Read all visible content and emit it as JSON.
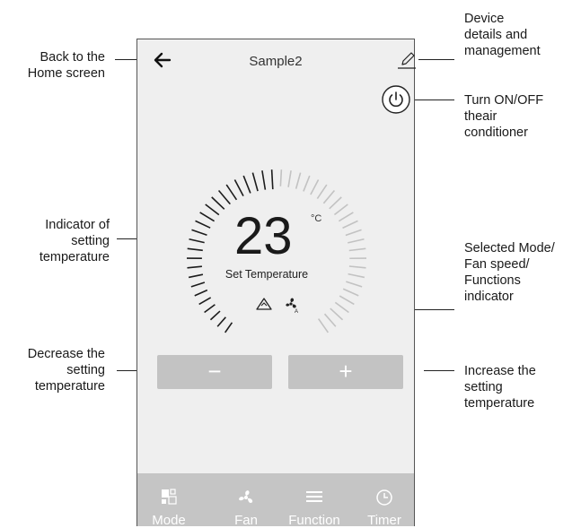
{
  "app": {
    "title": "Sample2",
    "temperature": "23",
    "unit": "°C",
    "set_label": "Set Temperature",
    "minus_label": "−",
    "plus_label": "+"
  },
  "tabs": [
    {
      "label": "Mode",
      "icon": "mode-icon"
    },
    {
      "label": "Fan",
      "icon": "fan-icon"
    },
    {
      "label": "Function",
      "icon": "menu-icon"
    },
    {
      "label": "Timer",
      "icon": "clock-icon"
    }
  ],
  "annotations": {
    "back": [
      "Back to the",
      "Home screen"
    ],
    "device": [
      "Device",
      "details and",
      "management"
    ],
    "power": [
      "Turn ON/OFF",
      "theair",
      "conditioner"
    ],
    "indicator": [
      "Indicator of",
      "setting",
      "temperature"
    ],
    "mode": [
      "Selected Mode/",
      "Fan speed/",
      "Functions",
      "indicator"
    ],
    "decrease": [
      "Decrease the",
      "setting",
      "temperature"
    ],
    "increase": [
      "Increase the",
      "setting",
      "temperature"
    ]
  },
  "colors": {
    "panel": "#efefef",
    "button": "#c3c3c3",
    "tabbar": "#c5c5c5"
  }
}
